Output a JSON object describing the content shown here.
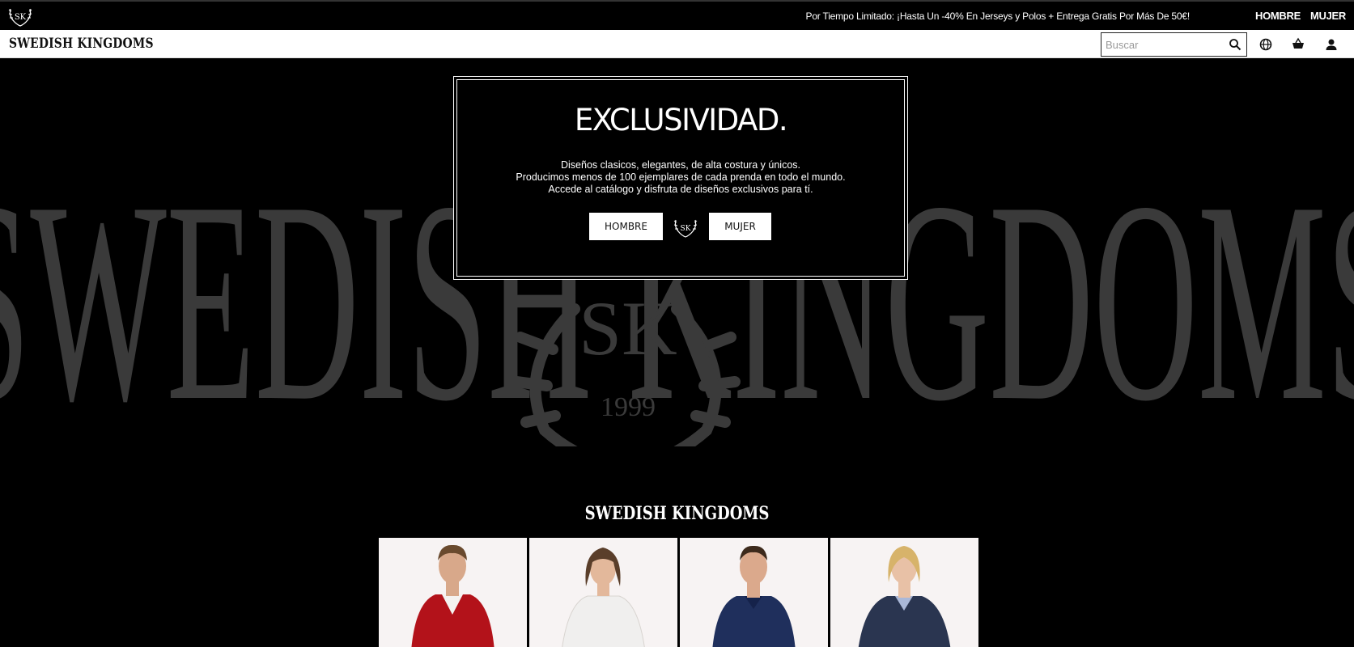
{
  "promo_bar": {
    "logo_icon": "sk-antler-logo-icon",
    "text": "Por Tiempo Limitado: ¡Hasta Un -40% En Jerseys y Polos + Entrega Gratis Por Más De 50€!",
    "nav": [
      "HOMBRE",
      "MUJER"
    ]
  },
  "header": {
    "brand": "SWEDISH KINGDOMS",
    "search_placeholder": "Buscar",
    "icons": [
      "search-icon",
      "globe-icon",
      "basket-icon",
      "user-icon"
    ]
  },
  "hero": {
    "watermark_text": "SWEDISH KINGDOMS",
    "emblem_text": "SK",
    "emblem_year": "1999",
    "modal": {
      "title": "EXCLUSIVIDAD.",
      "lines": [
        "Diseños clasicos, elegantes, de alta costura y únicos.",
        "Producimos menos de 100 ejemplares de cada prenda en todo el mundo.",
        "Accede al catálogo y disfruta de diseños exclusivos para tí."
      ],
      "button_men": "HOMBRE",
      "button_women": "MUJER"
    }
  },
  "products_section": {
    "title": "SWEDISH KINGDOMS",
    "products": [
      {
        "garment": "red-v-neck-sweater",
        "color": "#b3121a"
      },
      {
        "garment": "white-lace-top",
        "color": "#f0efee"
      },
      {
        "garment": "navy-polo",
        "color": "#1f2f5c"
      },
      {
        "garment": "navy-jacquard-blazer",
        "color": "#2a3550"
      }
    ]
  },
  "colors": {
    "background": "#000000",
    "header": "#ffffff",
    "watermark": "#3a3a3a"
  }
}
